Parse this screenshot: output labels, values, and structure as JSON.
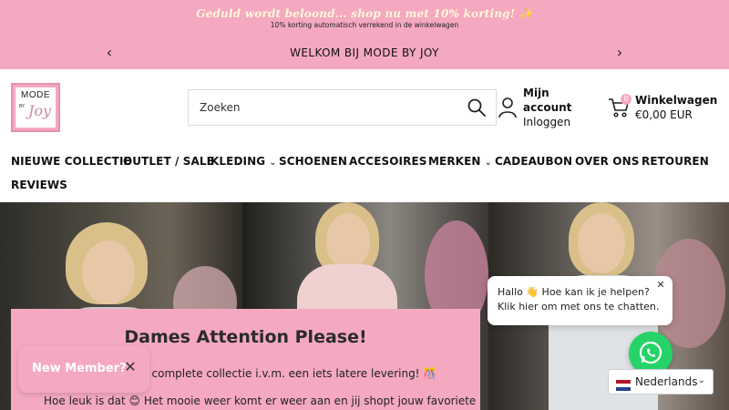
{
  "promo": {
    "title": "Geduld wordt beloond... shop nu met 10% korting!",
    "title_emoji": "✨",
    "subtitle": "10% korting automatisch verrekend in de winkelwagen"
  },
  "announcement": {
    "text": "WELKOM BIJ MODE BY JOY",
    "prev_icon": "chevron-left-icon",
    "next_icon": "chevron-right-icon"
  },
  "header": {
    "logo": {
      "top": "MODE",
      "by": "BY",
      "script": "Joy"
    },
    "search": {
      "placeholder": "Zoeken",
      "icon": "search-icon"
    },
    "account": {
      "title": "Mijn account",
      "link": "Inloggen",
      "icon": "user-icon"
    },
    "cart": {
      "title": "Winkelwagen",
      "total": "€0,00 EUR",
      "count": "0",
      "icon": "cart-icon"
    }
  },
  "nav": {
    "items": [
      {
        "label": "NIEUWE COLLECTIE",
        "dropdown": false
      },
      {
        "label": "OUTLET / SALE",
        "dropdown": false
      },
      {
        "label": "KLEDING",
        "dropdown": true
      },
      {
        "label": "SCHOENEN",
        "dropdown": false
      },
      {
        "label": "ACCESOIRES",
        "dropdown": false
      },
      {
        "label": "MERKEN",
        "dropdown": true
      },
      {
        "label": "CADEAUBON",
        "dropdown": false
      },
      {
        "label": "OVER ONS",
        "dropdown": false
      },
      {
        "label": "RETOUREN",
        "dropdown": false
      },
      {
        "label": "REVIEWS",
        "dropdown": false
      }
    ]
  },
  "hero_card": {
    "title": "Dames Attention Please!",
    "line1": "le complete collectie i.v.m. een iets latere levering! 🎊",
    "line2": "Hoe leuk is dat 😊 Het mooie weer komt er weer aan en jij shopt jouw favoriete"
  },
  "member_popup": {
    "label": "New Member?",
    "close": "✕"
  },
  "chat": {
    "line1": "Hallo 👋 Hoe kan ik je helpen?",
    "line2": "Klik hier om met ons te chatten.",
    "close": "✕",
    "icon": "whatsapp-icon"
  },
  "language": {
    "label": "Nederlands",
    "flag": "netherlands-flag-icon"
  },
  "colors": {
    "brand_pink": "#f4a9c0",
    "whatsapp_green": "#25d366"
  }
}
